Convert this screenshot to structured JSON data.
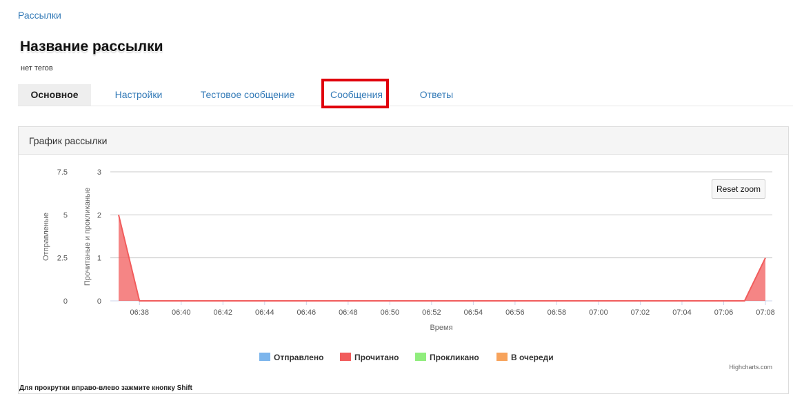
{
  "breadcrumb": "Рассылки",
  "title": "Название рассылки",
  "tags": "нет тегов",
  "tabs": [
    "Основное",
    "Настройки",
    "Тестовое сообщение",
    "Сообщения",
    "Ответы"
  ],
  "panel_title": "График рассылки",
  "reset_zoom": "Reset zoom",
  "credits": "Highcharts.com",
  "hint": "Для прокрутки вправо-влево зажмите кнопку Shift",
  "chart_data": {
    "type": "area",
    "xlabel": "Время",
    "ylabel_left": "Отправленые",
    "ylabel_right": "Прочитаные и прокликаные",
    "y_left_ticks": [
      "7.5",
      "5",
      "2.5",
      "0"
    ],
    "y_right_ticks": [
      "3",
      "2",
      "1",
      "0"
    ],
    "y_right_range": [
      0,
      3
    ],
    "x_ticks": [
      "06:38",
      "06:40",
      "06:42",
      "06:44",
      "06:46",
      "06:48",
      "06:50",
      "06:52",
      "06:54",
      "06:56",
      "06:58",
      "07:00",
      "07:02",
      "07:04",
      "07:06",
      "07:08"
    ],
    "x_range": [
      "06:37",
      "07:08"
    ],
    "legend": [
      {
        "name": "Отправлено",
        "color": "#7cb5ec"
      },
      {
        "name": "Прочитано",
        "color": "#f15c5c"
      },
      {
        "name": "Проклик­ано",
        "color": "#90ed7d"
      },
      {
        "name": "В очереди",
        "color": "#f7a35c"
      }
    ],
    "series": [
      {
        "name": "Прочитано",
        "color": "#f15c5c",
        "points": [
          [
            "06:37",
            2
          ],
          [
            "06:38",
            0
          ],
          [
            "07:07",
            0
          ],
          [
            "07:08",
            1
          ]
        ]
      }
    ]
  }
}
